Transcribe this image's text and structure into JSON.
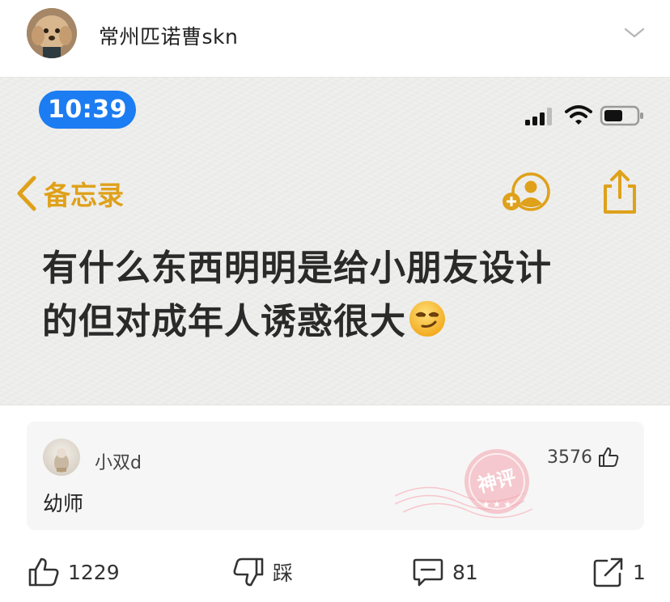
{
  "post": {
    "username": "常州匹诺曹skn",
    "avatar_icon": "dog-avatar",
    "menu_icon": "chevron-down-icon"
  },
  "screenshot": {
    "status_bar": {
      "time": "10:39",
      "time_pill_color": "#1c7cf2",
      "icons": [
        "signal-icon",
        "wifi-icon",
        "battery-icon"
      ]
    },
    "nav": {
      "back_label": "备忘录",
      "accent_color": "#dfa11a",
      "icons": [
        "back-chevron-icon",
        "add-person-icon",
        "share-icon"
      ]
    },
    "note": {
      "line1": "有什么东西明明是给小朋友设计",
      "line2": "的但对成年人诱惑很大",
      "emoji": "smirk-emoji"
    }
  },
  "comment": {
    "author": "小双d",
    "likes": "3576",
    "text": "幼师",
    "badge_text": "神评",
    "badge_color": "#f2a3ad"
  },
  "actions": {
    "like_count": "1229",
    "dislike_label": "踩",
    "comment_count": "81",
    "share_count": "1"
  }
}
